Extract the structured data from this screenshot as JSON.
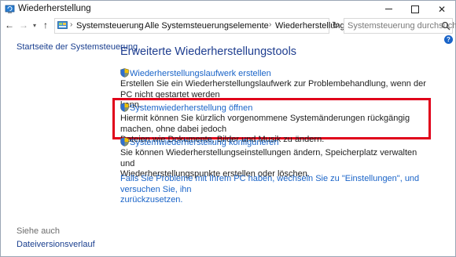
{
  "window": {
    "title": "Wiederherstellung"
  },
  "address": {
    "crumbs": [
      "Systemsteuerung",
      "Alle Systemsteuerungselemente",
      "Wiederherstellung"
    ],
    "search_placeholder": "Systemsteuerung durchsuchen"
  },
  "sidebar": {
    "home_link": "Startseite der Systemsteuerung",
    "see_also_heading": "Siehe auch",
    "see_also_link": "Dateiversionsverlauf"
  },
  "main": {
    "heading": "Erweiterte Wiederherstellungstools",
    "tools": [
      {
        "link": "Wiederherstellungslaufwerk erstellen",
        "desc_line1": "Erstellen Sie ein Wiederherstellungslaufwerk zur Problembehandlung, wenn der PC nicht gestartet werden",
        "desc_line2": "kann."
      },
      {
        "link": "Systemwiederherstellung öffnen",
        "desc_line1": "Hiermit können Sie kürzlich vorgenommene Systemänderungen rückgängig machen, ohne dabei jedoch",
        "desc_line2": "Dateien wie Dokumente, Bilder und Musik zu ändern."
      },
      {
        "link": "Systemwiederherstellung konfigurieren",
        "desc_line1": "Sie können Wiederherstellungseinstellungen ändern, Speicherplatz verwalten und",
        "desc_line2": "Wiederherstellungspunkte erstellen oder löschen."
      }
    ],
    "bottom_link_line1": "Falls Sie Probleme mit Ihrem PC haben, wechseln Sie zu \"Einstellungen\", und versuchen Sie, ihn",
    "bottom_link_line2": "zurückzusetzen."
  },
  "colors": {
    "link": "#1a64c8",
    "heading": "#1e3d8f",
    "highlight_border": "#e0001a"
  }
}
